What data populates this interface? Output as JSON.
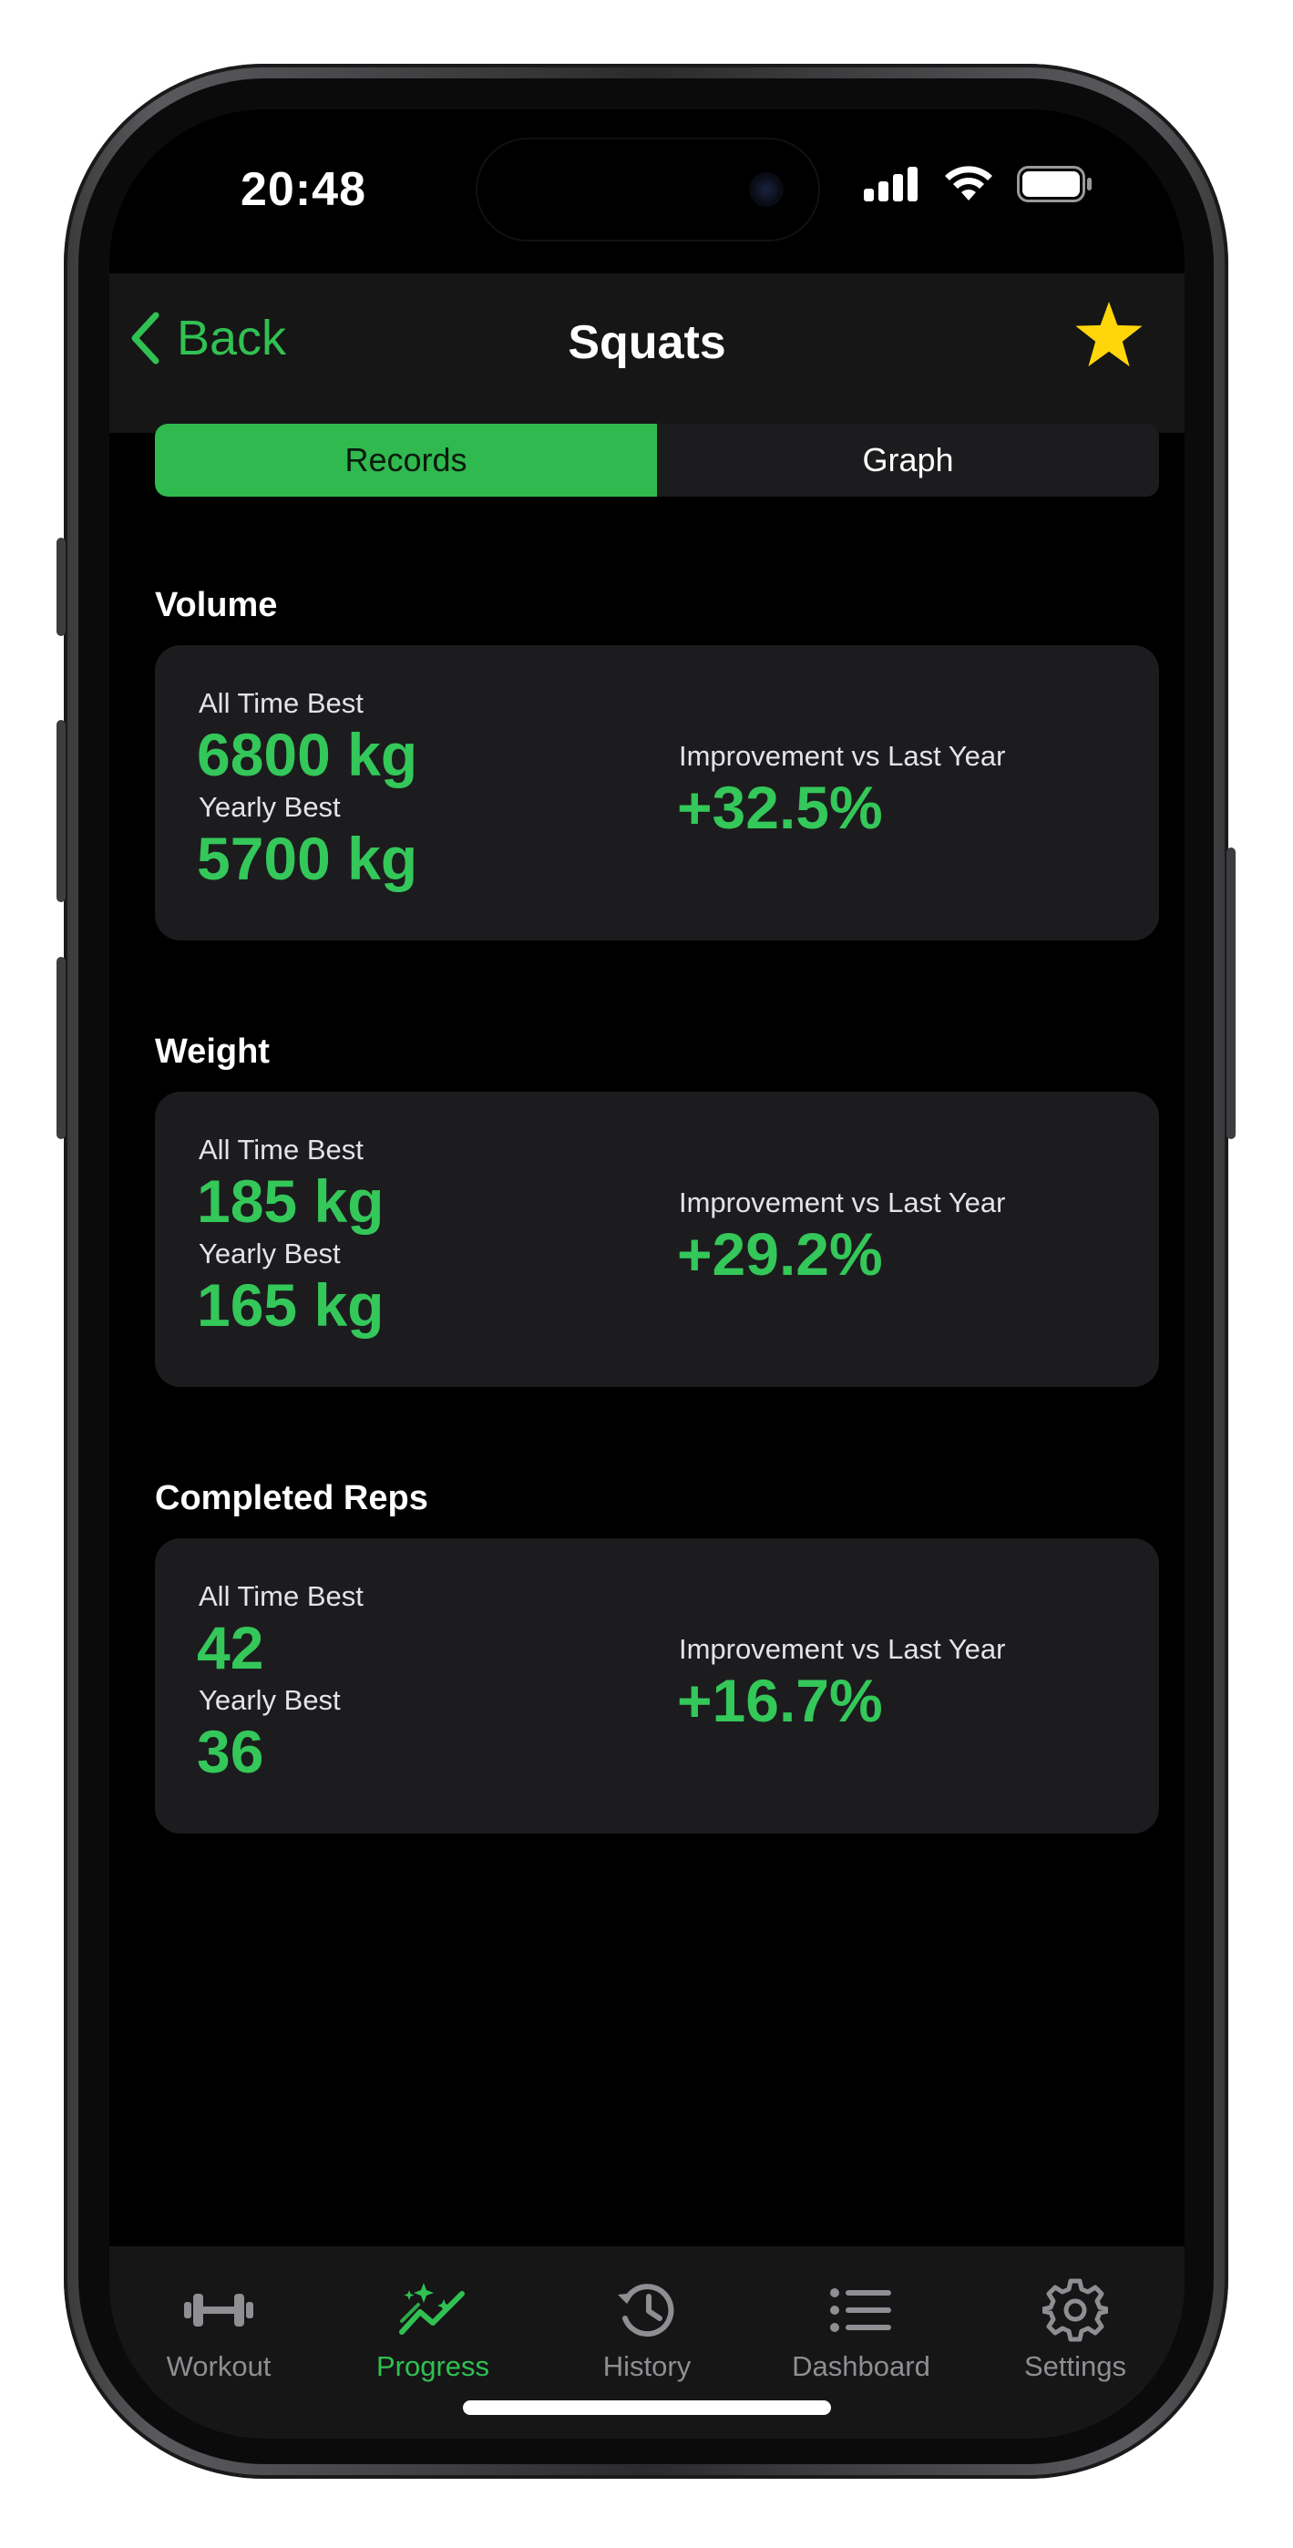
{
  "status_bar": {
    "time": "20:48",
    "icons": [
      "signal-icon",
      "wifi-icon",
      "battery-icon"
    ]
  },
  "nav": {
    "back_label": "Back",
    "title": "Squats",
    "favorite_icon": "star-icon",
    "favorite_color": "#FFD60A"
  },
  "segments": {
    "records": "Records",
    "graph": "Graph",
    "selected": "Records"
  },
  "sections": [
    {
      "title": "Volume",
      "all_time_label": "All Time Best",
      "all_time_value": "6800 kg",
      "yearly_label": "Yearly Best",
      "yearly_value": "5700 kg",
      "improvement_label": "Improvement vs Last Year",
      "improvement_value": "+32.5%"
    },
    {
      "title": "Weight",
      "all_time_label": "All Time Best",
      "all_time_value": "185 kg",
      "yearly_label": "Yearly Best",
      "yearly_value": "165 kg",
      "improvement_label": "Improvement vs Last Year",
      "improvement_value": "+29.2%"
    },
    {
      "title": "Completed Reps",
      "all_time_label": "All Time Best",
      "all_time_value": "42",
      "yearly_label": "Yearly Best",
      "yearly_value": "36",
      "improvement_label": "Improvement vs Last Year",
      "improvement_value": "+16.7%"
    }
  ],
  "tabs": [
    {
      "label": "Workout",
      "icon": "dumbbell-icon"
    },
    {
      "label": "Progress",
      "icon": "progress-chart-icon",
      "active": true
    },
    {
      "label": "History",
      "icon": "history-clock-icon"
    },
    {
      "label": "Dashboard",
      "icon": "list-icon"
    },
    {
      "label": "Settings",
      "icon": "gear-icon"
    }
  ],
  "colors": {
    "accent_green": "#34C759",
    "card_bg": "#1C1C1E",
    "inactive_tab": "#8E8E93"
  }
}
